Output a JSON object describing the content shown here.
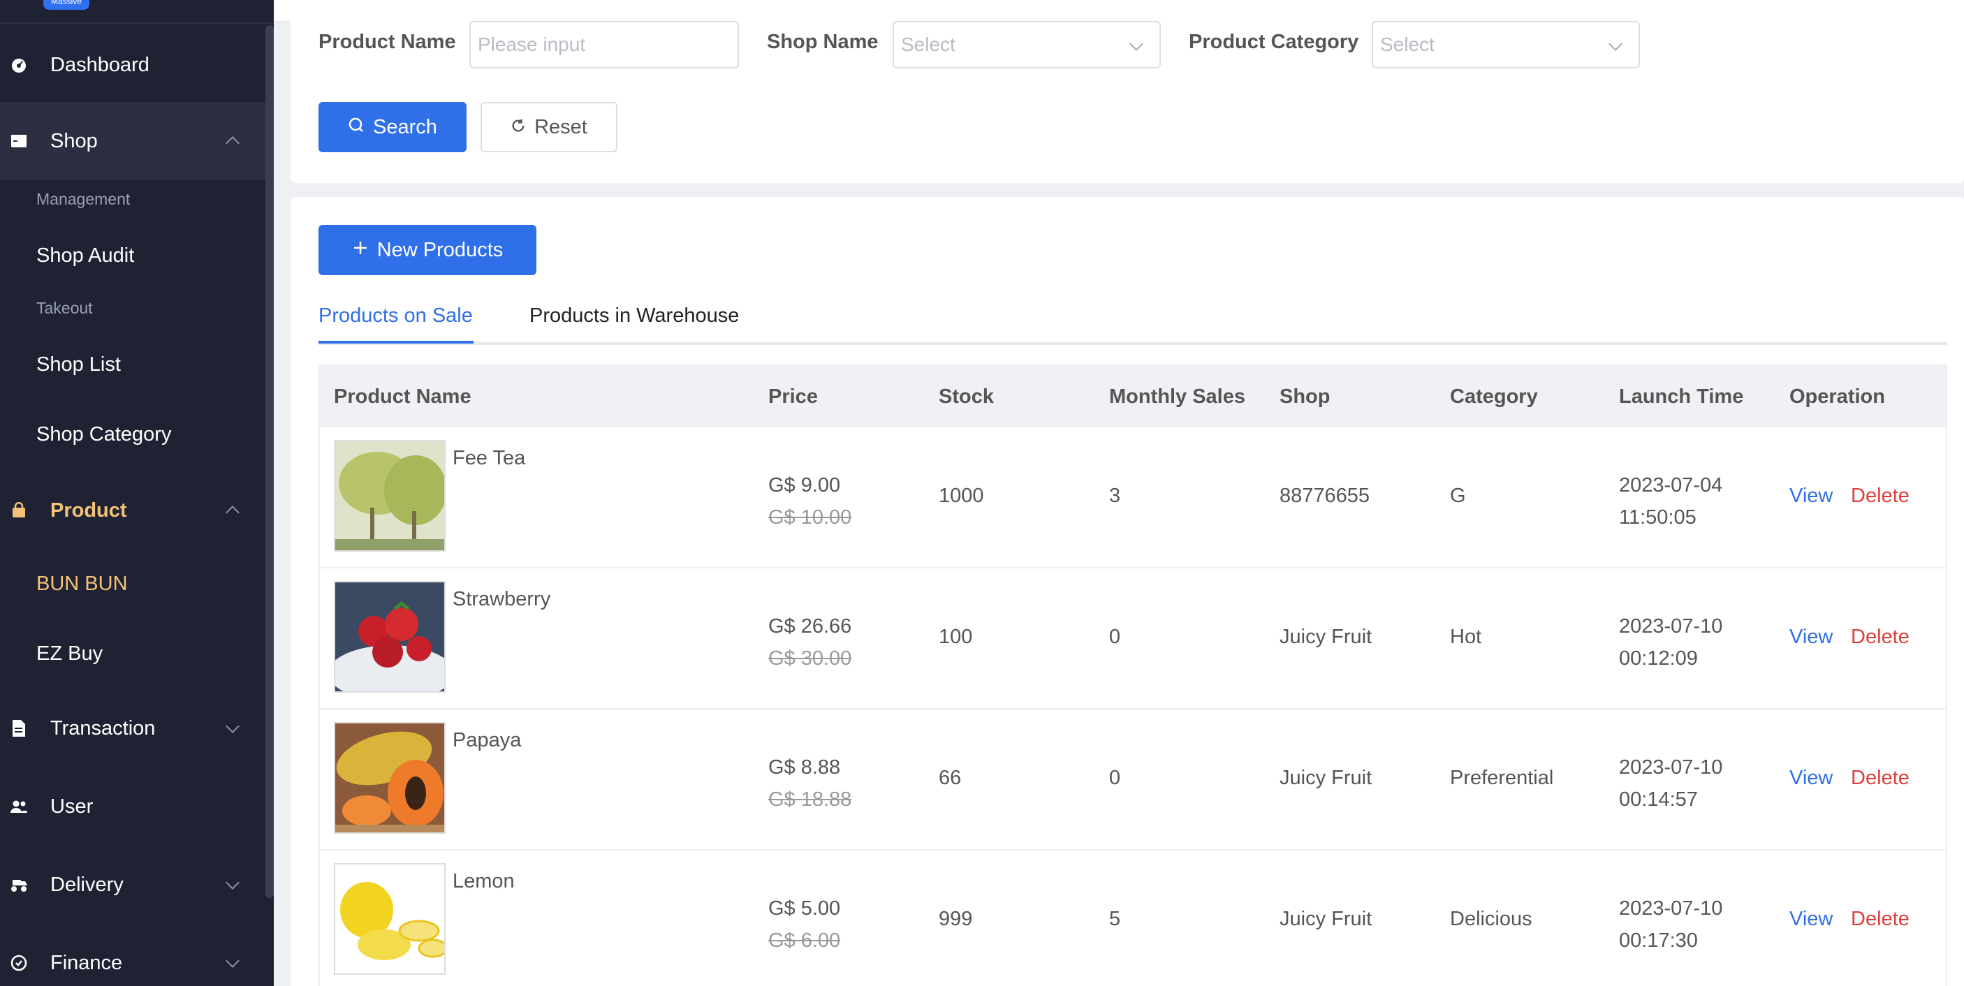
{
  "sidebar": {
    "logo_text": "Massive",
    "items": [
      {
        "label": "Dashboard",
        "icon": "dashboard-icon"
      },
      {
        "label": "Shop",
        "icon": "shop-icon"
      },
      {
        "label": "Product",
        "icon": "bag-icon"
      },
      {
        "label": "Transaction",
        "icon": "document-icon"
      },
      {
        "label": "User",
        "icon": "users-icon"
      },
      {
        "label": "Delivery",
        "icon": "delivery-icon"
      },
      {
        "label": "Finance",
        "icon": "finance-icon"
      }
    ],
    "shop_sub": {
      "group1": "Management",
      "shop_audit": "Shop Audit",
      "group2": "Takeout",
      "shop_list": "Shop List",
      "shop_category": "Shop Category"
    },
    "product_sub": {
      "bun_bun": "BUN BUN",
      "ez_buy": "EZ Buy"
    },
    "colors": {
      "bg": "#1f2233",
      "highlight": "#f3c277"
    }
  },
  "search": {
    "product_name_label": "Product Name",
    "product_name_placeholder": "Please input",
    "shop_name_label": "Shop Name",
    "shop_name_placeholder": "Select",
    "category_label": "Product Category",
    "category_placeholder": "Select",
    "search_button": "Search",
    "reset_button": "Reset"
  },
  "toolbar": {
    "new_products": "New Products"
  },
  "tabs": [
    {
      "label": "Products on Sale",
      "active": true
    },
    {
      "label": "Products in Warehouse",
      "active": false
    }
  ],
  "table": {
    "headers": [
      "Product Name",
      "Price",
      "Stock",
      "Monthly Sales",
      "Shop",
      "Category",
      "Launch Time",
      "Operation"
    ],
    "rows": [
      {
        "name": "Fee Tea",
        "price": "G$ 9.00",
        "old_price": "G$ 10.00",
        "stock": "1000",
        "sales": "3",
        "shop": "88776655",
        "category": "G",
        "date": "2023-07-04",
        "time": "11:50:05",
        "view": "View",
        "delete": "Delete"
      },
      {
        "name": "Strawberry",
        "price": "G$ 26.66",
        "old_price": "G$ 30.00",
        "stock": "100",
        "sales": "0",
        "shop": "Juicy Fruit",
        "category": "Hot",
        "date": "2023-07-10",
        "time": "00:12:09",
        "view": "View",
        "delete": "Delete"
      },
      {
        "name": "Papaya",
        "price": "G$ 8.88",
        "old_price": "G$ 18.88",
        "stock": "66",
        "sales": "0",
        "shop": "Juicy Fruit",
        "category": "Preferential",
        "date": "2023-07-10",
        "time": "00:14:57",
        "view": "View",
        "delete": "Delete"
      },
      {
        "name": "Lemon",
        "price": "G$ 5.00",
        "old_price": "G$ 6.00",
        "stock": "999",
        "sales": "5",
        "shop": "Juicy Fruit",
        "category": "Delicious",
        "date": "2023-07-10",
        "time": "00:17:30",
        "view": "View",
        "delete": "Delete"
      }
    ]
  },
  "colors": {
    "primary": "#2f6fe8",
    "danger": "#e03c3c"
  }
}
